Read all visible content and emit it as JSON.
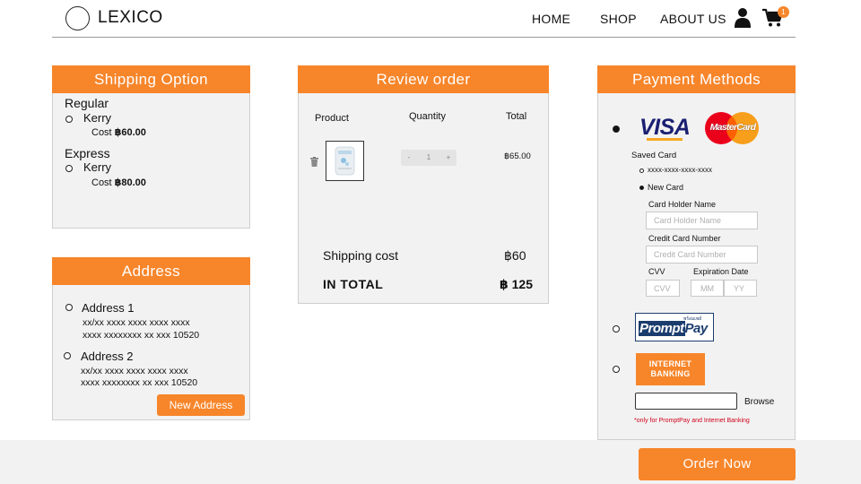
{
  "header": {
    "logo": "LEXICO",
    "nav": [
      "HOME",
      "SHOP",
      "ABOUT US"
    ],
    "cart_count": "1"
  },
  "shipping": {
    "title": "Shipping Option",
    "regular": {
      "label": "Regular",
      "carrier": "Kerry",
      "cost_label": "Cost",
      "cost_value": "฿60.00"
    },
    "express": {
      "label": "Express",
      "carrier": "Kerry",
      "cost_label": "Cost",
      "cost_value": "฿80.00"
    }
  },
  "address": {
    "title": "Address",
    "items": [
      {
        "name": "Address 1",
        "line1": "xx/xx xxxx xxxx xxxx xxxx",
        "line2": "xxxx xxxxxxxx xx xxx 10520"
      },
      {
        "name": "Address 2",
        "line1": "xx/xx xxxx xxxx xxxx xxxx",
        "line2": "xxxx xxxxxxxx xx xxx 10520"
      }
    ],
    "new_button": "New Address"
  },
  "review": {
    "title": "Review order",
    "columns": [
      "Product",
      "Quantity",
      "Total"
    ],
    "item": {
      "minus": "-",
      "qty": "1",
      "plus": "+",
      "total": "฿65.00"
    },
    "shipping_label": "Shipping cost",
    "shipping_value": "฿60",
    "total_label": "IN TOTAL",
    "total_value": "฿ 125"
  },
  "payment": {
    "title": "Payment Methods",
    "visa": "VISA",
    "mastercard": "MasterCard",
    "saved_card_label": "Saved Card",
    "saved_card_number": "xxxx-xxxx-xxxx-xxxx",
    "new_card_label": "New Card",
    "holder_label": "Card Holder Name",
    "holder_placeholder": "Card Holder Name",
    "number_label": "Credit Card Number",
    "number_placeholder": "Credit Card Number",
    "cvv_label": "CVV",
    "cvv_placeholder": "CVV",
    "expiry_label": "Expiration Date",
    "mm_placeholder": "MM",
    "yy_placeholder": "YY",
    "promptpay_small": "พร้อมเพย์",
    "promptpay_prompt": "Prompt",
    "promptpay_pay": "Pay",
    "internet_banking_1": "INTERNET",
    "internet_banking_2": "BANKING",
    "browse": "Browse",
    "note": "*only for PromptPay and Internet Banking"
  },
  "order_button": "Order Now",
  "colors": {
    "accent": "#f7852a",
    "panel_bg": "#f2f2f2",
    "note_red": "#d0021b"
  }
}
